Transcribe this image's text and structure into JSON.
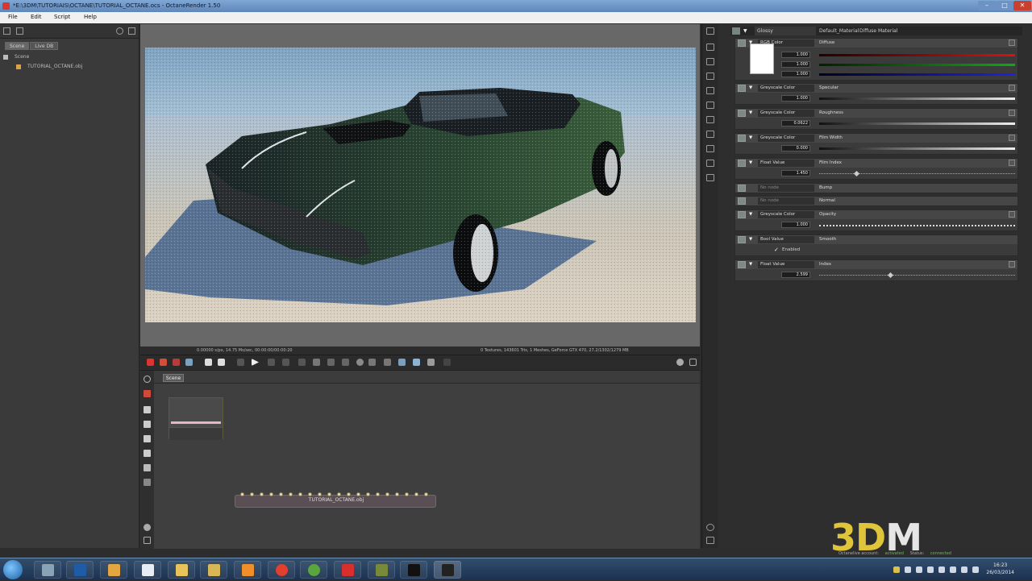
{
  "window": {
    "title": "*E:\\3DM\\TUTORIAIS\\OCTANE\\TUTORIAL_OCTANE.ocs - OctaneRender 1.50",
    "controls": {
      "minimize": "–",
      "maximize": "□",
      "close": "✕"
    }
  },
  "menu": {
    "items": [
      "File",
      "Edit",
      "Script",
      "Help"
    ]
  },
  "left_panel": {
    "tabs": [
      "Scene",
      "Live DB"
    ],
    "tree": [
      {
        "label": "Scene"
      },
      {
        "label": "TUTORIAL_OCTANE.obj"
      }
    ]
  },
  "viewport": {
    "status_left": "0.00000 s/px, 14.75 Ms/sec, 00:00:00/00:00:20",
    "status_right": "0 Textures, 143601 Tris, 1 Meshes, GeForce GTX 470, 27.2/1302/1279 MB"
  },
  "node_graph": {
    "tab": "Scene",
    "mesh_node_label": "TUTORIAL_OCTANE.obj"
  },
  "inspector": {
    "header": {
      "type": "Glossy",
      "name": "Default_Material",
      "kind": "Diffuse Material"
    },
    "rows": [
      {
        "type": "RGB Color",
        "name": "Diffuse",
        "values": [
          "1.000",
          "1.000",
          "1.000"
        ]
      },
      {
        "type": "Greyscale Color",
        "name": "Specular",
        "values": [
          "1.000"
        ]
      },
      {
        "type": "Greyscale Color",
        "name": "Roughness",
        "values": [
          "0.0622"
        ]
      },
      {
        "type": "Greyscale Color",
        "name": "Film Width",
        "values": [
          "0.000"
        ]
      },
      {
        "type": "Float Value",
        "name": "Film Index",
        "values": [
          "1.450"
        ]
      },
      {
        "type": "No node",
        "name": "Bump",
        "values": []
      },
      {
        "type": "No node",
        "name": "Normal",
        "values": []
      },
      {
        "type": "Greyscale Color",
        "name": "Opacity",
        "values": [
          "1.000"
        ]
      },
      {
        "type": "Bool Value",
        "name": "Smooth",
        "values": [],
        "checkbox_label": "Enabled"
      },
      {
        "type": "Float Value",
        "name": "Index",
        "values": [
          "2.599"
        ]
      }
    ]
  },
  "branding": {
    "logo_part1": "3D",
    "logo_part2": "M",
    "status_items": [
      "Octanelive account:",
      "activated",
      "Status:",
      "connected"
    ]
  },
  "taskbar": {
    "apps": [
      "explorer",
      "photoshop",
      "3d",
      "word",
      "folder",
      "folder",
      "media",
      "chrome",
      "utorrent",
      "app",
      "app",
      "app",
      "app"
    ],
    "clock_time": "16:23",
    "clock_date": "26/03/2014"
  }
}
